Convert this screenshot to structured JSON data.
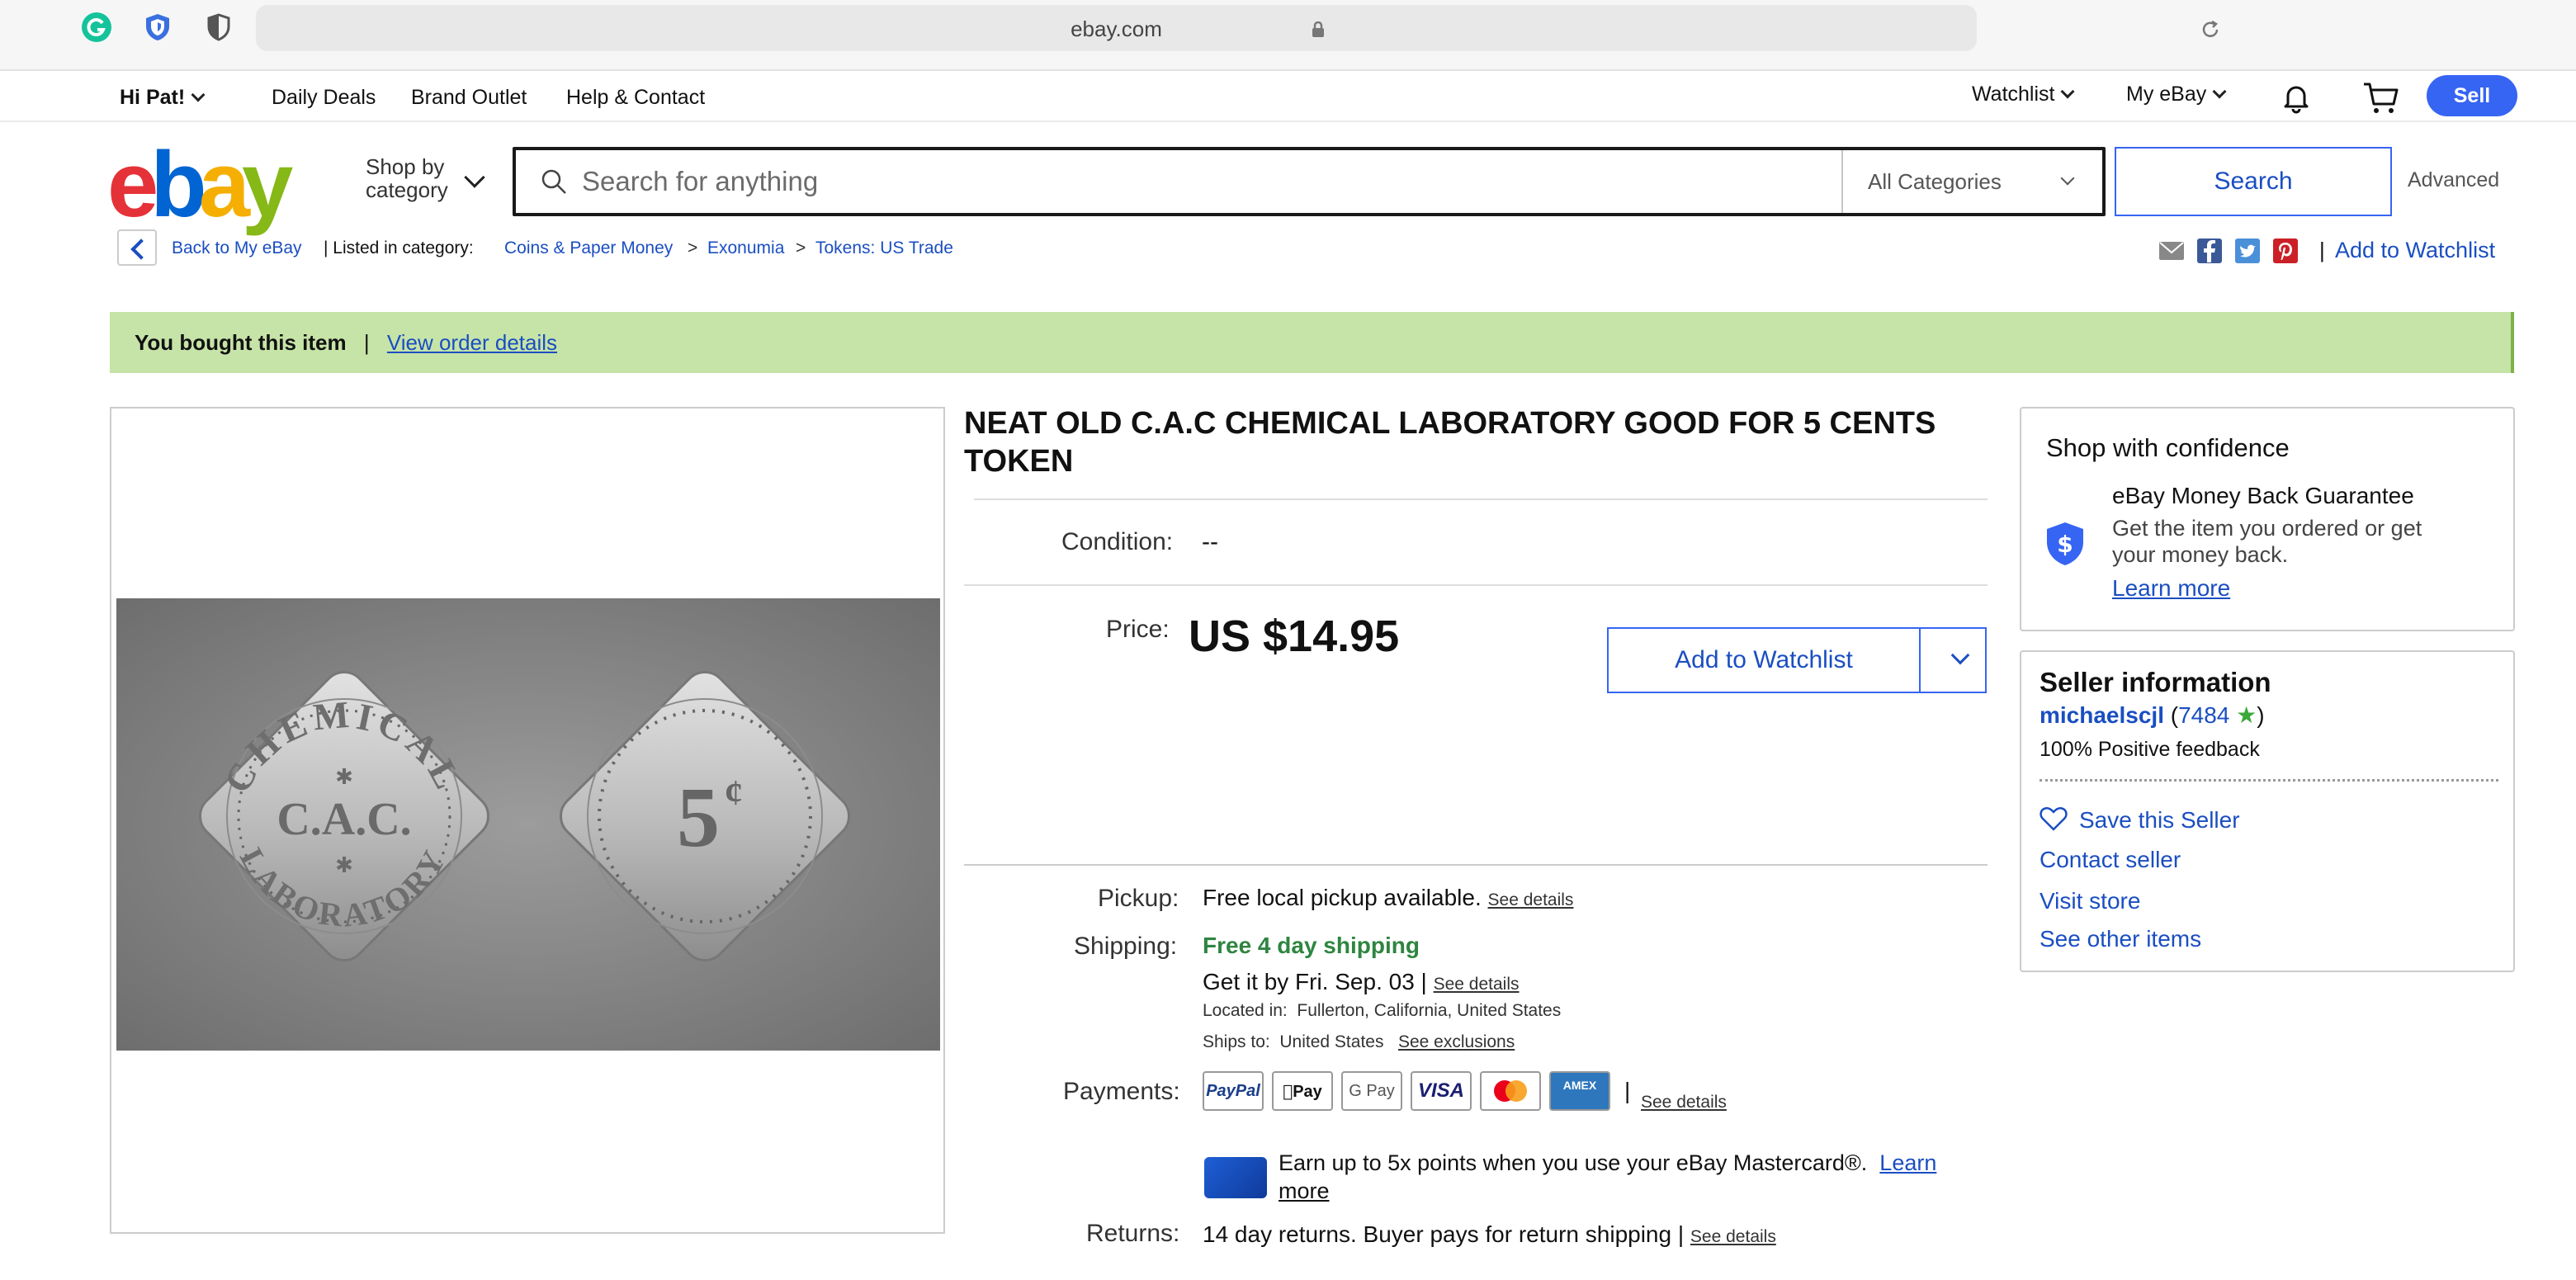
{
  "browser": {
    "url": "ebay.com"
  },
  "topnav": {
    "greeting": "Hi Pat!",
    "daily_deals": "Daily Deals",
    "brand_outlet": "Brand Outlet",
    "help": "Help & Contact",
    "watchlist": "Watchlist",
    "my_ebay": "My eBay",
    "sell": "Sell"
  },
  "search": {
    "shop_by_line1": "Shop by",
    "shop_by_line2": "category",
    "placeholder": "Search for anything",
    "category": "All Categories",
    "button": "Search",
    "advanced": "Advanced"
  },
  "logo": [
    "e",
    "b",
    "a",
    "y"
  ],
  "breadcrumb": {
    "back": "Back to My eBay",
    "listed_in": "| Listed in category:",
    "items": [
      "Coins & Paper Money",
      "Exonumia",
      "Tokens: US Trade"
    ],
    "separator": ">",
    "add_to_watchlist": "Add to Watchlist"
  },
  "banner": {
    "text": "You bought this item",
    "separator": "|",
    "link": "View order details"
  },
  "item": {
    "title": "NEAT OLD C.A.C CHEMICAL LABORATORY GOOD FOR 5 CENTS TOKEN",
    "condition_label": "Condition:",
    "condition_value": "--",
    "price_label": "Price:",
    "price": "US $14.95",
    "watch_button": "Add to Watchlist",
    "pickup_label": "Pickup:",
    "pickup_value": "Free local pickup available.",
    "see_details": "See details",
    "shipping_label": "Shipping:",
    "shipping_value": "Free 4 day shipping",
    "delivery": "Get it by Fri. Sep. 03 |",
    "located_label": "Located in:",
    "located_value": "Fullerton, California, United States",
    "ships_label": "Ships to:",
    "ships_value": "United States",
    "see_exclusions": "See exclusions",
    "payments_label": "Payments:",
    "payment_methods": [
      "PayPal",
      "Pay",
      "G Pay",
      "VISA",
      "MC",
      "AMEX"
    ],
    "mastercard_line1": "Earn up to 5x points when you use your eBay Mastercard®.",
    "mastercard_link1": "Learn",
    "mastercard_link2": "more",
    "returns_label": "Returns:",
    "returns_value": "14 day returns. Buyer pays for return shipping |"
  },
  "confidence": {
    "heading": "Shop with confidence",
    "guarantee_title": "eBay Money Back Guarantee",
    "guarantee_line1": "Get the item you ordered or get",
    "guarantee_line2": "your money back.",
    "learn_more": "Learn more"
  },
  "seller": {
    "heading": "Seller information",
    "name": "michaelscjl",
    "feedback_score": "7484",
    "positive": "100% Positive feedback",
    "save": "Save this Seller",
    "contact": "Contact seller",
    "visit": "Visit store",
    "other": "See other items"
  },
  "token_front": {
    "top": "CHEMICAL",
    "middle": "C.A.C.",
    "bottom": "LABORATORY"
  },
  "token_back": {
    "denomination": "5",
    "unit": "¢"
  },
  "colors": {
    "accent": "#3665f3",
    "link": "#1a4ec2",
    "banner": "#c6e4a7",
    "shipping_green": "#2e8540"
  }
}
